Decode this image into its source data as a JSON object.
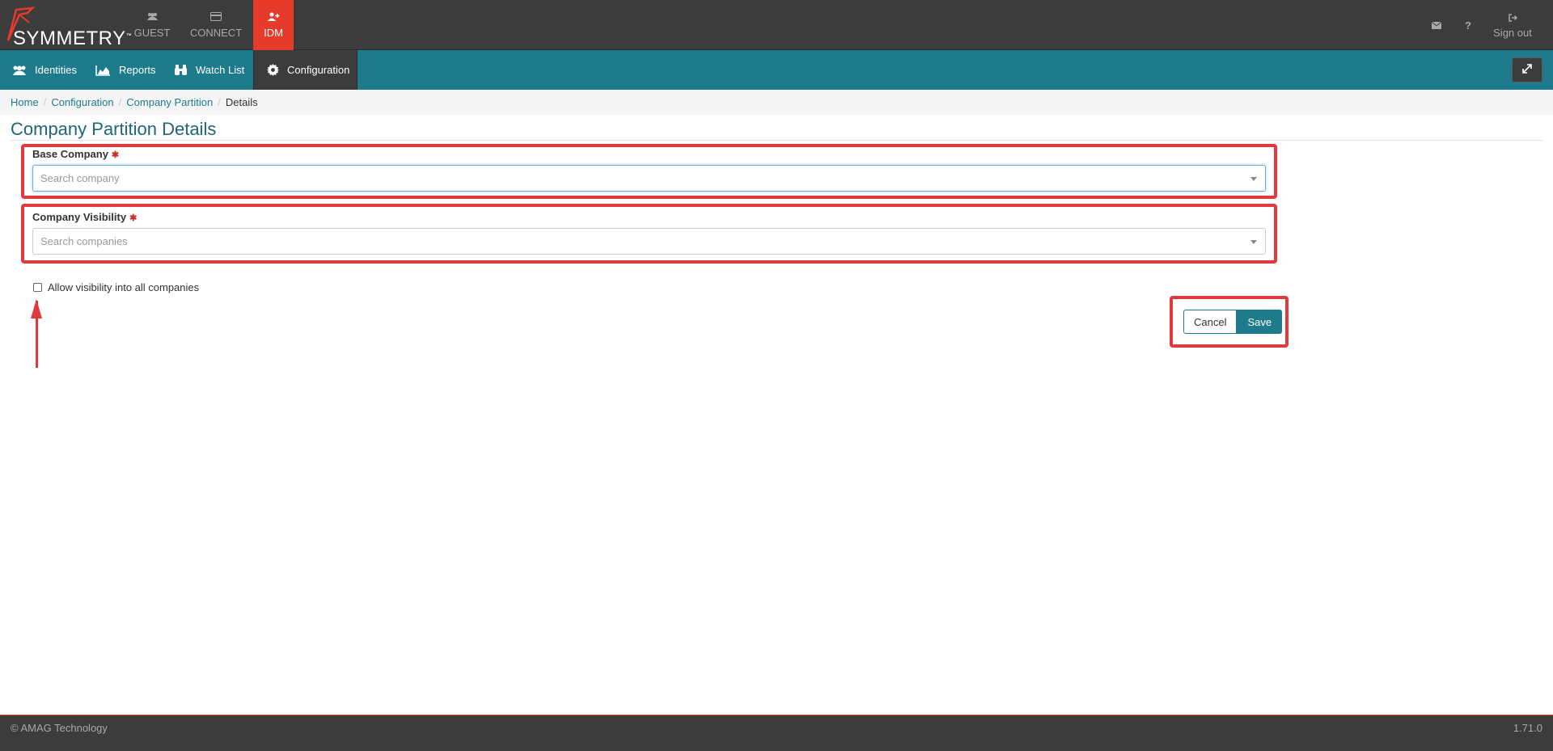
{
  "topbar": {
    "logo_text": "SYMMETRY",
    "logo_tm": "™",
    "nav": [
      {
        "label": "GUEST",
        "icon": "users-icon"
      },
      {
        "label": "CONNECT",
        "icon": "card-icon"
      },
      {
        "label": "IDM",
        "icon": "user-plus-icon"
      }
    ],
    "right": {
      "mail_icon": "mail-icon",
      "help_label": "?",
      "signout_label": "Sign out"
    },
    "colors": {
      "bar": "#3c3c3c",
      "active": "#e63a2b"
    }
  },
  "subnav": {
    "items": [
      {
        "label": "Identities",
        "icon": "users-icon"
      },
      {
        "label": "Reports",
        "icon": "area-chart-icon"
      },
      {
        "label": "Watch List",
        "icon": "binoculars-icon"
      },
      {
        "label": "Configuration",
        "icon": "gear-icon"
      }
    ],
    "color": "#1e7b8c"
  },
  "breadcrumb": {
    "items": [
      "Home",
      "Configuration",
      "Company Partition"
    ],
    "current": "Details"
  },
  "page": {
    "title": "Company Partition Details"
  },
  "form": {
    "base_company": {
      "label": "Base Company",
      "required_mark": "✱",
      "placeholder": "Search company"
    },
    "company_visibility": {
      "label": "Company Visibility",
      "required_mark": "✱",
      "placeholder": "Search companies"
    },
    "allow_all": {
      "label": "Allow visibility into all companies",
      "checked": false
    },
    "cancel_label": "Cancel",
    "save_label": "Save"
  },
  "footer": {
    "copyright": "© AMAG Technology",
    "version": "1.71.0"
  }
}
